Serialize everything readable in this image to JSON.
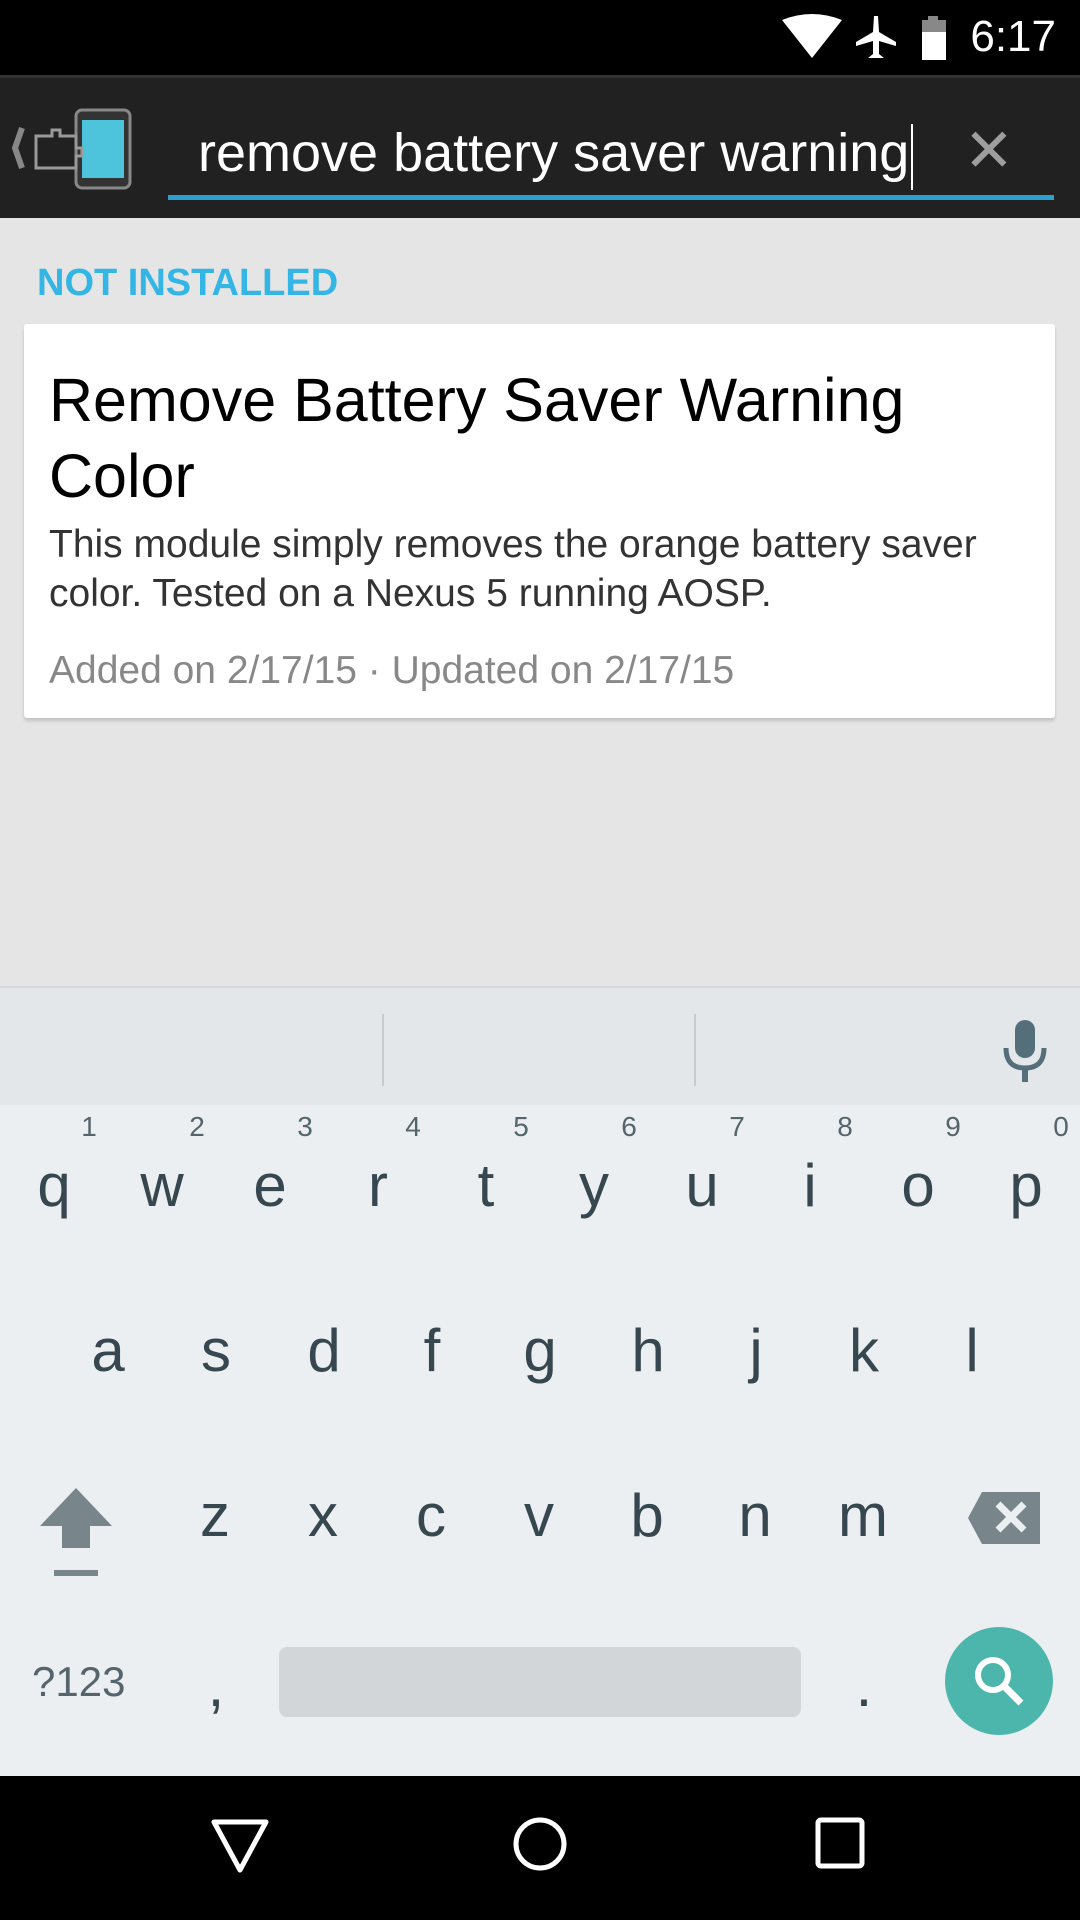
{
  "status_bar": {
    "time": "6:17",
    "icons": [
      "wifi-icon",
      "airplane-icon",
      "battery-icon"
    ]
  },
  "toolbar": {
    "app_icon": "xposed-puzzle-icon",
    "search_value": "remove battery saver warning",
    "clear_icon": "close-icon",
    "clear_label": "✕"
  },
  "section": {
    "label": "NOT INSTALLED"
  },
  "card": {
    "title": "Remove Battery Saver Warning Color",
    "description": "This module simply removes the orange battery saver color. Tested on a Nexus 5 running AOSP.",
    "meta": "Added on 2/17/15 · Updated on 2/17/15"
  },
  "keyboard": {
    "row1": [
      "q",
      "w",
      "e",
      "r",
      "t",
      "y",
      "u",
      "i",
      "o",
      "p"
    ],
    "row1_hints": [
      "1",
      "2",
      "3",
      "4",
      "5",
      "6",
      "7",
      "8",
      "9",
      "0"
    ],
    "row2": [
      "a",
      "s",
      "d",
      "f",
      "g",
      "h",
      "j",
      "k",
      "l"
    ],
    "row3": [
      "z",
      "x",
      "c",
      "v",
      "b",
      "n",
      "m"
    ],
    "symbols_label": "?123",
    "comma": ",",
    "period": ".",
    "accent": "#4db6ac"
  },
  "accent": "#33b5e5"
}
